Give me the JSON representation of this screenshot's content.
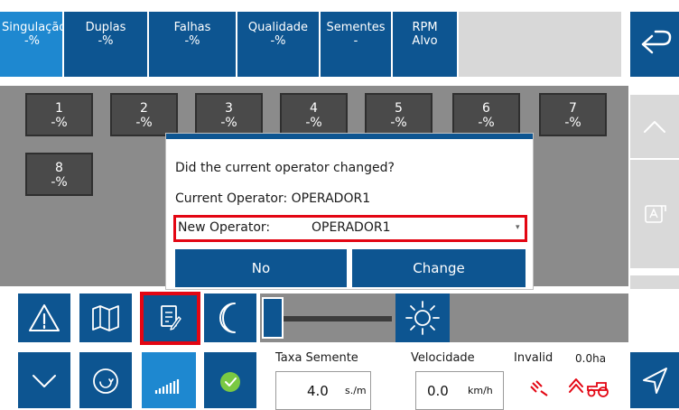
{
  "tabs": [
    {
      "line1": "Singulação",
      "line2": "-%",
      "active": true
    },
    {
      "line1": "Duplas",
      "line2": "-%"
    },
    {
      "line1": "Falhas",
      "line2": "-%"
    },
    {
      "line1": "Qualidade",
      "line2": "-%"
    },
    {
      "line1": "Sementes",
      "line2": "-"
    },
    {
      "line1": "RPM",
      "line2": "Alvo"
    }
  ],
  "rows": [
    {
      "num": "1",
      "val": "-%"
    },
    {
      "num": "2",
      "val": "-%"
    },
    {
      "num": "3",
      "val": "-%"
    },
    {
      "num": "4",
      "val": "-%"
    },
    {
      "num": "5",
      "val": "-%"
    },
    {
      "num": "6",
      "val": "-%"
    },
    {
      "num": "7",
      "val": "-%"
    },
    {
      "num": "8",
      "val": "-%"
    }
  ],
  "dialog": {
    "question": "Did the current operator changed?",
    "current_label": "Current Operator: OPERADOR1",
    "new_label": "New Operator:",
    "new_value": "OPERADOR1",
    "no_label": "No",
    "change_label": "Change"
  },
  "bottom": {
    "taxa_label": "Taxa Semente",
    "taxa_value": "4.0",
    "taxa_unit": "s./m",
    "vel_label": "Velocidade",
    "vel_value": "0.0",
    "vel_unit": "km/h",
    "status": "Invalid",
    "area": "0.0ha"
  },
  "colors": {
    "primary": "#0d5591",
    "active_tab": "#1e88d0",
    "highlight": "#e30613",
    "ok_green": "#7ac943"
  },
  "icons": {
    "back": "return-arrow-icon",
    "up": "chevron-up-icon",
    "down": "chevron-down-icon",
    "export": "export-icon",
    "warning": "warning-icon",
    "map": "map-icon",
    "notes": "notes-edit-icon",
    "night": "moon-icon",
    "day": "sun-icon",
    "expand": "chevron-down-icon",
    "gps": "gps-refresh-icon",
    "signal": "signal-bars-icon",
    "ok": "check-circle-icon",
    "navigate": "navigation-arrow-icon"
  }
}
